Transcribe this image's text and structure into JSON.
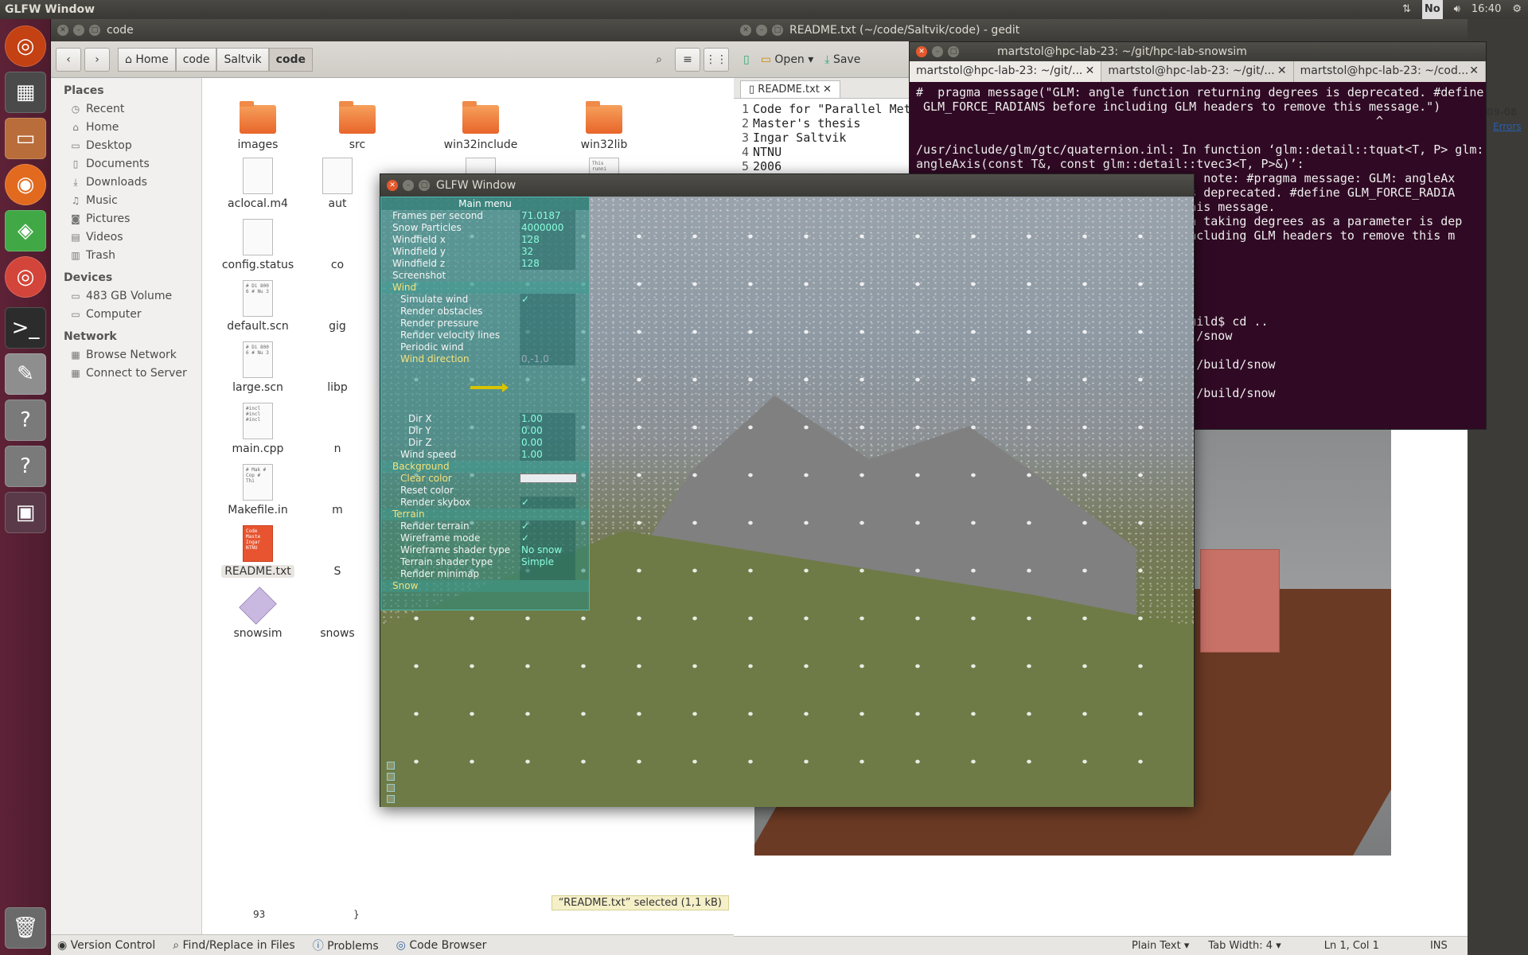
{
  "topbar": {
    "title": "GLFW Window",
    "tray": {
      "lang": "No",
      "time": "16:40"
    }
  },
  "launcher": {
    "items": [
      "ubuntu-icon",
      "calculator-icon",
      "files-icon",
      "firefox-icon",
      "qt-creator-icon",
      "chrome-icon",
      "terminal-icon",
      "text-editor-icon",
      "help-icon",
      "help-icon",
      "workspace-icon",
      "trash-icon"
    ]
  },
  "filemanager": {
    "title": "code",
    "breadcrumbs": [
      "Home",
      "code",
      "Saltvik",
      "code"
    ],
    "sidebar": {
      "places_header": "Places",
      "places": [
        "Recent",
        "Home",
        "Desktop",
        "Documents",
        "Downloads",
        "Music",
        "Pictures",
        "Videos",
        "Trash"
      ],
      "devices_header": "Devices",
      "devices": [
        "483 GB Volume",
        "Computer"
      ],
      "network_header": "Network",
      "network": [
        "Browse Network",
        "Connect to Server"
      ]
    },
    "files": [
      {
        "name": "images",
        "type": "folder"
      },
      {
        "name": "src",
        "type": "folder"
      },
      {
        "name": "win32include",
        "type": "folder"
      },
      {
        "name": "win32lib",
        "type": "folder"
      },
      {
        "name": "aclocal.m4",
        "type": "doc"
      },
      {
        "name": "aut",
        "type": "doc"
      },
      {
        "name": "",
        "type": "doc"
      },
      {
        "name": "",
        "type": "doc",
        "preview": "This runni"
      },
      {
        "name": "config.status",
        "type": "doc"
      },
      {
        "name": "co",
        "type": "doc"
      },
      {
        "name": "default.scn",
        "type": "doc",
        "preview": "# Di 800 6 # Nu 3"
      },
      {
        "name": "gig",
        "type": "doc"
      },
      {
        "name": "large.scn",
        "type": "doc",
        "preview": "# Di 800 6 # Nu 3"
      },
      {
        "name": "libp",
        "type": "doc"
      },
      {
        "name": "main.cpp",
        "type": "doc",
        "preview": "#incl #incl #incl"
      },
      {
        "name": "n",
        "type": "doc"
      },
      {
        "name": "Makefile.in",
        "type": "doc",
        "preview": "# Mak # Cop # Thi"
      },
      {
        "name": "m",
        "type": "doc"
      },
      {
        "name": "README.txt",
        "type": "doc-red",
        "preview": "Code Maste Ingar NTNU"
      },
      {
        "name": "S",
        "type": "doc"
      },
      {
        "name": "snowsim",
        "type": "exec"
      },
      {
        "name": "snows",
        "type": "doc"
      }
    ],
    "status": "“README.txt” selected (1,1 kB)"
  },
  "bottompanel": {
    "items": [
      "Version Control",
      "Find/Replace in Files",
      "Problems",
      "Code Browser"
    ],
    "line_left": "93",
    "line_right": "}"
  },
  "gedit": {
    "title": "README.txt (~/code/Saltvik/code) - gedit",
    "toolbar": {
      "open": "Open",
      "save": "Save"
    },
    "tab": "README.txt",
    "lines": [
      {
        "n": "1",
        "t": "Code for \"Parallel Met"
      },
      {
        "n": "2",
        "t": "Master's thesis"
      },
      {
        "n": "3",
        "t": "Ingar Saltvik"
      },
      {
        "n": "4",
        "t": "NTNU"
      },
      {
        "n": "5",
        "t": "2006"
      }
    ],
    "status": {
      "mode": "Plain Text",
      "tab": "Tab Width: 4",
      "pos": "Ln 1, Col 1",
      "ins": "INS"
    },
    "side_label": "09-08",
    "side_link": "Errors"
  },
  "terminal": {
    "title": "martstol@hpc-lab-23: ~/git/hpc-lab-snowsim",
    "tabs": [
      "martstol@hpc-lab-23: ~/git/...",
      "martstol@hpc-lab-23: ~/git/...",
      "martstol@hpc-lab-23: ~/cod..."
    ],
    "lines": [
      "#  pragma message(\"GLM: angle function returning degrees is deprecated. #define",
      " GLM_FORCE_RADIANS before including GLM headers to remove this message.\")",
      "                                                                ^",
      "",
      "/usr/include/glm/gtc/quaternion.inl: In function ‘glm::detail::tquat<T, P> glm::",
      "angleAxis(const T&, const glm::detail::tvec3<T, P>&)’:",
      "                                   168: note: #pragma message: GLM: angleAx",
      "                                   r is deprecated. #define GLM_FORCE_RADIA",
      "                                   e this message.",
      "                                   tion taking degrees as a parameter is dep",
      "                                   e including GLM headers to remove this m",
      "",
      "",
      "",
      "",
      "",
      "                                   m/build$ cd ..",
      "                                   m$ ./snow",
      "",
      "                                   m$ ./build/snow",
      "",
      "                                   m$ ./build/snow"
    ]
  },
  "glfw": {
    "title": "GLFW Window",
    "menu": {
      "title": "Main menu",
      "stats": [
        {
          "k": "Frames per second",
          "v": "71.0187"
        },
        {
          "k": "Snow Particles",
          "v": "4000000"
        },
        {
          "k": "Windfield x",
          "v": "128"
        },
        {
          "k": "Windfield y",
          "v": "32"
        },
        {
          "k": "Windfield z",
          "v": "128"
        },
        {
          "k": "Screenshot",
          "v": ""
        }
      ],
      "wind_group": "Wind",
      "wind": [
        {
          "k": "Simulate wind",
          "v": "✓"
        },
        {
          "k": "Render obstacles",
          "v": ""
        },
        {
          "k": "Render pressure",
          "v": ""
        },
        {
          "k": "Render velocity lines",
          "v": ""
        },
        {
          "k": "Periodic wind",
          "v": ""
        }
      ],
      "wind_direction": "Wind direction",
      "wind_direction_value": "0,-1,0",
      "dir": [
        {
          "k": "Dir X",
          "v": "1.00"
        },
        {
          "k": "Dir Y",
          "v": "0.00"
        },
        {
          "k": "Dir Z",
          "v": "0.00"
        }
      ],
      "wind_speed": {
        "k": "Wind speed",
        "v": "1.00"
      },
      "background_group": "Background",
      "clear_color": "Clear color",
      "reset_color": "Reset color",
      "render_skybox": {
        "k": "Render skybox",
        "v": "✓"
      },
      "terrain_group": "Terrain",
      "terrain": [
        {
          "k": "Render terrain",
          "v": "✓"
        },
        {
          "k": "Wireframe mode",
          "v": "✓"
        },
        {
          "k": "Wireframe shader type",
          "v": "No snow"
        },
        {
          "k": "Terrain shader type",
          "v": "Simple"
        },
        {
          "k": "Render minimap",
          "v": ""
        }
      ],
      "snow_group": "Snow"
    }
  }
}
